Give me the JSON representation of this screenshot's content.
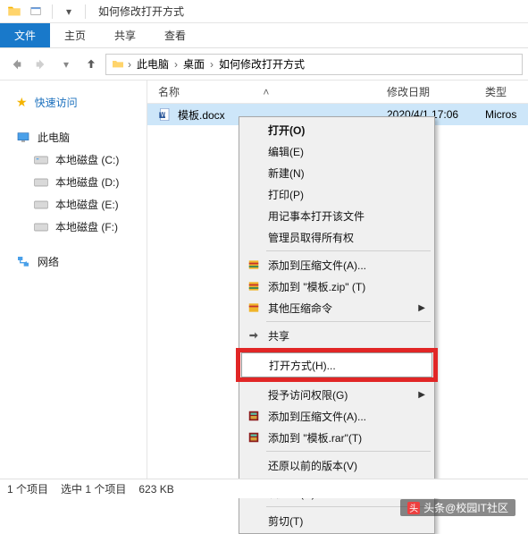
{
  "window": {
    "title": "如何修改打开方式"
  },
  "ribbon": {
    "file": "文件",
    "tabs": [
      "主页",
      "共享",
      "查看"
    ]
  },
  "breadcrumb": {
    "items": [
      "此电脑",
      "桌面",
      "如何修改打开方式"
    ]
  },
  "sidebar": {
    "quick_access": "快速访问",
    "this_pc": "此电脑",
    "drives": [
      "本地磁盘 (C:)",
      "本地磁盘 (D:)",
      "本地磁盘 (E:)",
      "本地磁盘 (F:)"
    ],
    "network": "网络"
  },
  "columns": {
    "name": "名称",
    "date": "修改日期",
    "type": "类型"
  },
  "file": {
    "name": "模板.docx",
    "date": "2020/4/1 17:06",
    "type": "Micros"
  },
  "context_menu": {
    "open": "打开(O)",
    "edit": "编辑(E)",
    "new": "新建(N)",
    "print": "打印(P)",
    "notepad": "用记事本打开该文件",
    "admin": "管理员取得所有权",
    "compress_a": "添加到压缩文件(A)...",
    "compress_zip": "添加到 \"模板.zip\" (T)",
    "other_compress": "其他压缩命令",
    "share": "共享",
    "open_with": "打开方式(H)...",
    "grant_access": "授予访问权限(G)",
    "add_rar_a": "添加到压缩文件(A)...",
    "add_rar_t": "添加到 \"模板.rar\"(T)",
    "restore": "还原以前的版本(V)",
    "send_to": "发送到(N)",
    "cut": "剪切(T)"
  },
  "status": {
    "items": "1 个项目",
    "selected": "选中 1 个项目",
    "size": "623 KB"
  },
  "watermark": "头条@校园IT社区"
}
